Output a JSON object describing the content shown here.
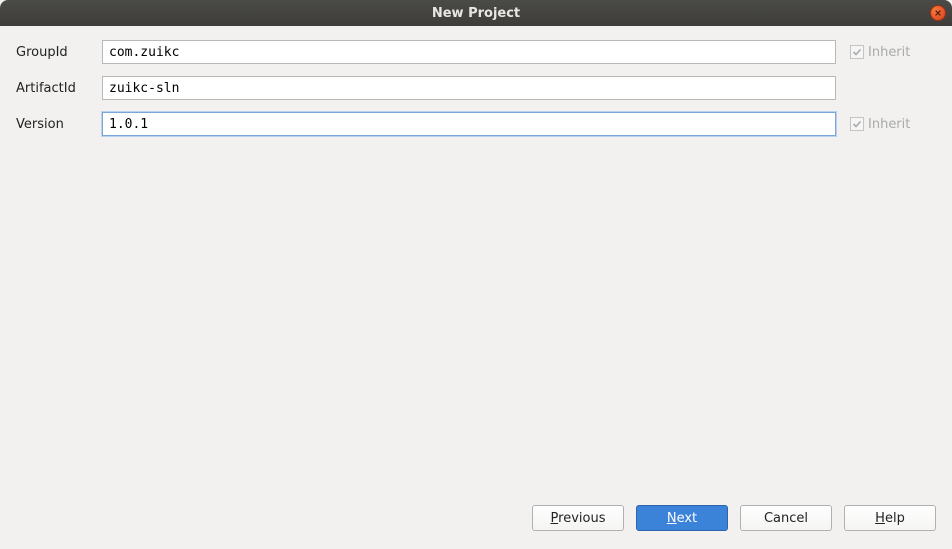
{
  "window": {
    "title": "New Project"
  },
  "form": {
    "groupid": {
      "label": "GroupId",
      "value": "com.zuikc",
      "inherit_label": "Inherit"
    },
    "artifactid": {
      "label": "ArtifactId",
      "value": "zuikc-sln"
    },
    "version": {
      "label": "Version",
      "value": "1.0.1",
      "inherit_label": "Inherit"
    }
  },
  "buttons": {
    "previous_pre": "P",
    "previous_rest": "revious",
    "next_pre": "N",
    "next_rest": "ext",
    "cancel": "Cancel",
    "help_pre": "H",
    "help_rest": "elp"
  }
}
